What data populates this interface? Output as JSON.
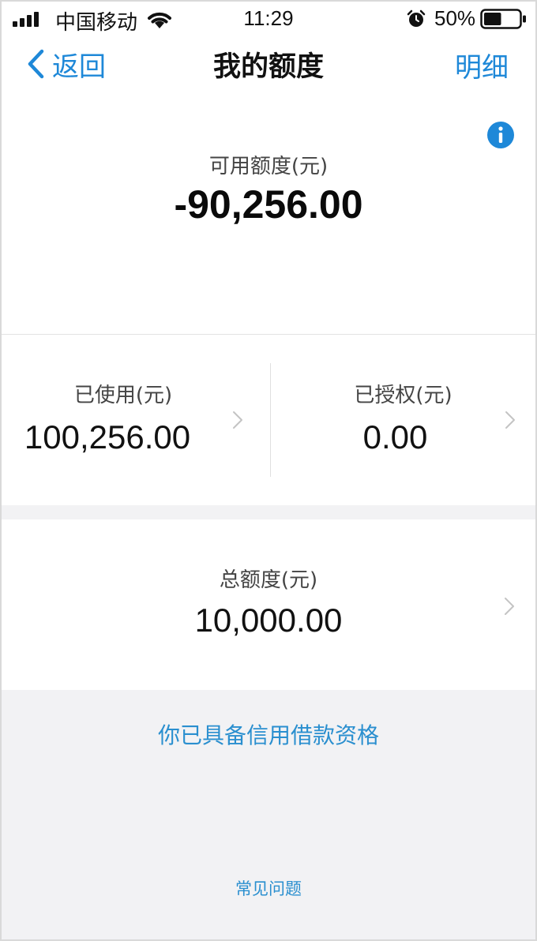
{
  "status_bar": {
    "carrier": "中国移动",
    "time": "11:29",
    "battery_percent": "50%",
    "battery_level": 0.5,
    "icons": [
      "signal-icon",
      "wifi-icon",
      "alarm-icon",
      "battery-icon"
    ]
  },
  "nav": {
    "back_label": "返回",
    "title": "我的额度",
    "detail_label": "明细"
  },
  "available": {
    "label": "可用额度(元)",
    "value": "-90,256.00"
  },
  "used": {
    "label": "已使用(元)",
    "value": "100,256.00"
  },
  "authorized": {
    "label": "已授权(元)",
    "value": "0.00"
  },
  "total": {
    "label": "总额度(元)",
    "value": "10,000.00"
  },
  "footer": {
    "eligible_text": "你已具备信用借款资格",
    "faq_text": "常见问题"
  },
  "colors": {
    "accent": "#1e88d8",
    "link": "#2a8fcf",
    "background_grey": "#f2f2f4"
  }
}
